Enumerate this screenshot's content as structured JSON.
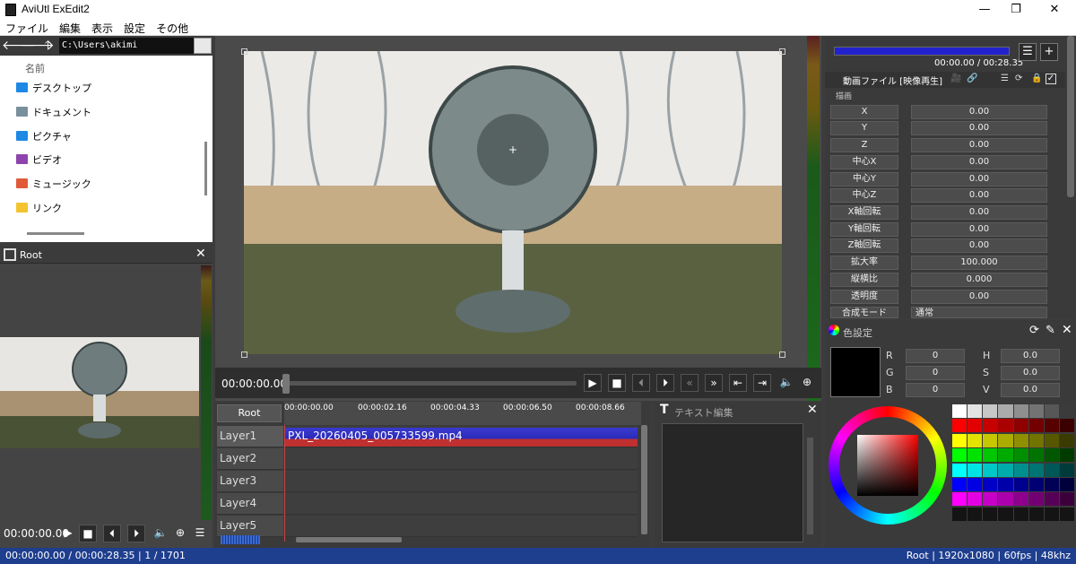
{
  "window": {
    "title": "AviUtl ExEdit2",
    "minimize": "—",
    "maximize": "❐",
    "close": "✕"
  },
  "menu": [
    "ファイル",
    "編集",
    "表示",
    "設定",
    "その他"
  ],
  "explorer": {
    "path": "C:\\Users\\akimi",
    "header": "名前",
    "items": [
      {
        "label": "デスクトップ",
        "color": "#1e88e5"
      },
      {
        "label": "ドキュメント",
        "color": "#78909c"
      },
      {
        "label": "ピクチャ",
        "color": "#1e88e5"
      },
      {
        "label": "ビデオ",
        "color": "#8e44ad"
      },
      {
        "label": "ミュージック",
        "color": "#e05a3a"
      },
      {
        "label": "リンク",
        "color": "#f4c430"
      }
    ]
  },
  "root_panel": {
    "title": "Root",
    "time": "00:00:00.00"
  },
  "preview": {
    "time": "00:00:00.00"
  },
  "timeline": {
    "root_label": "Root",
    "ticks": [
      "00:00:00.00",
      "00:00:02.16",
      "00:00:04.33",
      "00:00:06.50",
      "00:00:08.66"
    ],
    "layers": [
      "Layer1",
      "Layer2",
      "Layer3",
      "Layer4",
      "Layer5"
    ],
    "clip": "PXL_20260405_005733599.mp4"
  },
  "text_edit": {
    "title": "テキスト編集"
  },
  "props": {
    "time": "00:00.00 / 00:28.35",
    "object_title": "動画ファイル [映像再生]",
    "section": "描画",
    "params": [
      {
        "label": "X",
        "value": "0.00"
      },
      {
        "label": "Y",
        "value": "0.00"
      },
      {
        "label": "Z",
        "value": "0.00"
      },
      {
        "label": "中心X",
        "value": "0.00"
      },
      {
        "label": "中心Y",
        "value": "0.00"
      },
      {
        "label": "中心Z",
        "value": "0.00"
      },
      {
        "label": "X軸回転",
        "value": "0.00"
      },
      {
        "label": "Y軸回転",
        "value": "0.00"
      },
      {
        "label": "Z軸回転",
        "value": "0.00"
      },
      {
        "label": "拡大率",
        "value": "100.000"
      },
      {
        "label": "縦横比",
        "value": "0.000"
      },
      {
        "label": "透明度",
        "value": "0.00"
      },
      {
        "label": "合成モード",
        "value": "通常"
      }
    ]
  },
  "color": {
    "title": "色設定",
    "R": "0",
    "G": "0",
    "B": "0",
    "H": "0.0",
    "S": "0.0",
    "V": "0.0"
  },
  "status": {
    "left": "00:00:00.00 / 00:00:28.35  |  1 / 1701",
    "right": "Root  |  1920x1080  |  60fps  |  48khz"
  }
}
